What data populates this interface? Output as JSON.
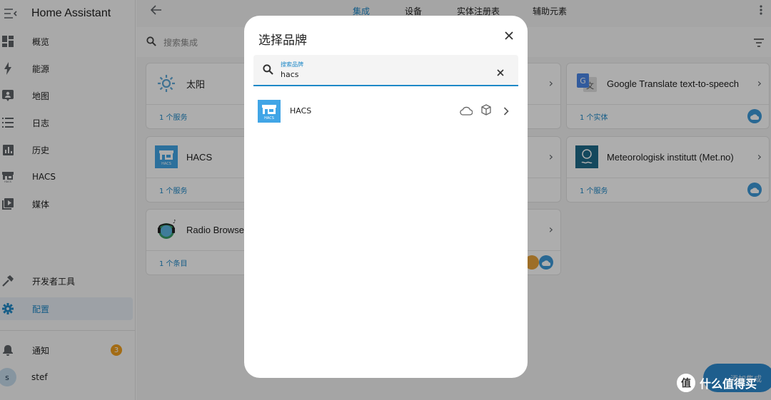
{
  "app": {
    "title": "Home Assistant"
  },
  "sidebar": {
    "items": [
      {
        "label": "概览",
        "icon": "dashboard-icon"
      },
      {
        "label": "能源",
        "icon": "lightning-icon"
      },
      {
        "label": "地图",
        "icon": "map-person-icon"
      },
      {
        "label": "日志",
        "icon": "list-icon"
      },
      {
        "label": "历史",
        "icon": "chart-icon"
      },
      {
        "label": "HACS",
        "icon": "hacs-icon"
      },
      {
        "label": "媒体",
        "icon": "media-icon"
      }
    ],
    "dev_tools": "开发者工具",
    "settings": "配置",
    "notifications": "通知",
    "notification_count": "3",
    "user_initial": "s",
    "user_name": "stef"
  },
  "header": {
    "tabs": [
      "集成",
      "设备",
      "实体注册表",
      "辅助元素"
    ],
    "active_tab": "集成"
  },
  "search": {
    "placeholder": "搜索集成"
  },
  "cards": [
    {
      "name": "太阳",
      "link": "1 个服务"
    },
    {
      "name": "HACS",
      "link": "1 个服务"
    },
    {
      "name": "Radio Browser",
      "link": "1 个条目"
    },
    {
      "name": "Google Translate text-to-speech",
      "link": "1 个实体"
    },
    {
      "name": "Meteorologisk institutt (Met.no)",
      "link": "1 个服务"
    }
  ],
  "dialog": {
    "title": "选择品牌",
    "search_label": "搜索品牌",
    "search_value": "hacs",
    "results": [
      {
        "name": "HACS",
        "logo_text": "HACS"
      }
    ]
  },
  "fab": {
    "label": "添加集成"
  },
  "watermark": {
    "logo_char": "值",
    "text": "什么值得买"
  },
  "colors": {
    "accent": "#1e88c7",
    "hacs_blue": "#41a5e6",
    "cloud_blue": "#3d9ad9",
    "badge_orange": "#f0a020"
  }
}
